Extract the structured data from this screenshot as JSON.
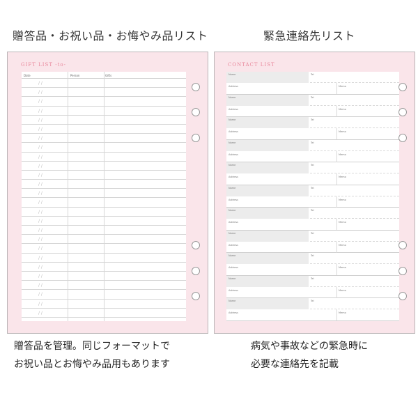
{
  "captions": {
    "left_title": "贈答品・お祝い品・お悔やみ品リスト",
    "right_title": "緊急連絡先リスト",
    "left_desc_line1": "贈答品を管理。同じフォーマットで",
    "left_desc_line2": "お祝い品とお悔やみ品用もあります",
    "right_desc_line1": "病気や事故などの緊急時に",
    "right_desc_line2": "必要な連絡先を記載"
  },
  "gift_sheet": {
    "title": "GIFT LIST -to-",
    "columns": [
      "Date",
      "Person",
      "Gifts"
    ],
    "row_count": 26,
    "date_slashes": "/   /"
  },
  "contact_sheet": {
    "title": "CONTACT LIST",
    "block_count": 11,
    "labels": {
      "name": "Name",
      "tel": "Tel",
      "address": "Address",
      "memo": "Memo"
    }
  },
  "colors": {
    "sheet_bg": "#fae5ea",
    "title_pink": "#e9889c",
    "name_field_gray": "#ececec"
  }
}
